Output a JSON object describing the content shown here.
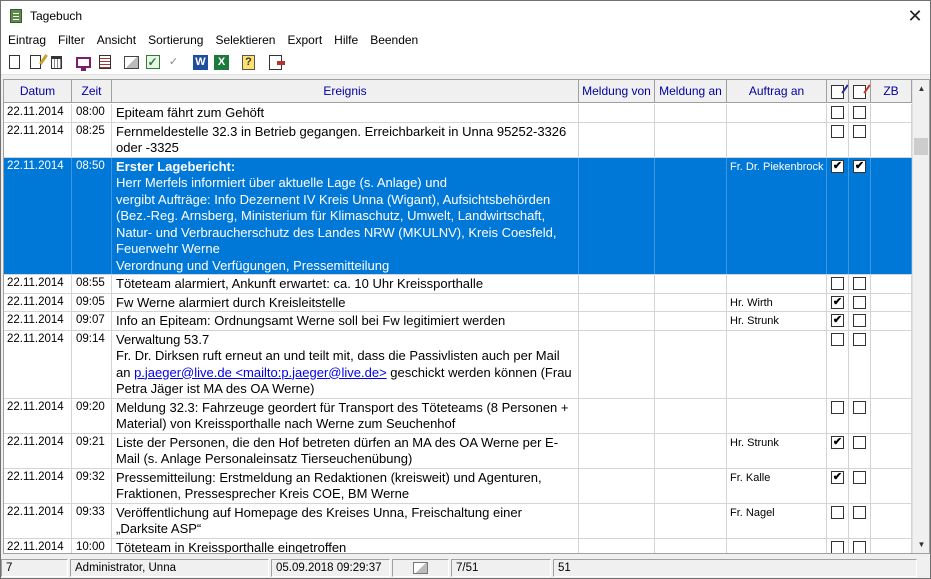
{
  "window": {
    "title": "Tagebuch",
    "close_glyph": "✕"
  },
  "menu": [
    "Eintrag",
    "Filter",
    "Ansicht",
    "Sortierung",
    "Selektieren",
    "Export",
    "Hilfe",
    "Beenden"
  ],
  "toolbar": {
    "icons": [
      "new-entry-icon",
      "edit-entry-icon",
      "delete-entry-icon",
      "monitor-icon",
      "document-list-icon",
      "folders-icon",
      "check-icon",
      "tick-icon",
      "word-export-icon",
      "excel-export-icon",
      "help-icon",
      "exit-icon"
    ],
    "word_glyph": "W",
    "excel_glyph": "X",
    "help_glyph": "?"
  },
  "columns": {
    "date": "Datum",
    "time": "Zeit",
    "event": "Ereignis",
    "meldung_von": "Meldung von",
    "meldung_an": "Meldung an",
    "auftrag_an": "Auftrag an",
    "zb": "ZB"
  },
  "rows": [
    {
      "date": "22.11.2014",
      "time": "08:00",
      "event": [
        "Epiteam fährt zum Gehöft"
      ],
      "auftrag": "",
      "cb1": "",
      "cb2": ""
    },
    {
      "date": "22.11.2014",
      "time": "08:25",
      "event": [
        "Fernmeldestelle 32.3 in Betrieb gegangen. Erreichbarkeit in Unna 95252-3326",
        "oder -3325"
      ],
      "auftrag": "",
      "cb1": "",
      "cb2": ""
    },
    {
      "date": "22.11.2014",
      "time": "08:50",
      "title": "Erster Lagebericht:",
      "event": [
        "Herr Merfels informiert über aktuelle Lage (s. Anlage) und",
        "vergibt Aufträge: Info Dezernent IV Kreis Unna (Wigant), Aufsichtsbehörden",
        "(Bez.-Reg. Arnsberg, Ministerium für Klimaschutz, Umwelt, Landwirtschaft,",
        "Natur- und Verbraucherschutz des Landes NRW (MKULNV), Kreis Coesfeld,",
        "Feuerwehr Werne",
        "Verordnung und Verfügungen, Pressemitteilung"
      ],
      "auftrag": "Fr. Dr. Piekenbrock",
      "cb1": "✔",
      "cb2": "✔",
      "selected": true
    },
    {
      "date": "22.11.2014",
      "time": "08:55",
      "event": [
        "Töteteam alarmiert, Ankunft erwartet: ca. 10 Uhr Kreissporthalle"
      ],
      "auftrag": "",
      "cb1": "",
      "cb2": ""
    },
    {
      "date": "22.11.2014",
      "time": "09:05",
      "event": [
        "Fw Werne alarmiert durch Kreisleitstelle"
      ],
      "auftrag": "Hr. Wirth",
      "cb1": "✔",
      "cb2": ""
    },
    {
      "date": "22.11.2014",
      "time": "09:07",
      "event": [
        "Info an Epiteam: Ordnungsamt Werne soll bei Fw legitimiert werden"
      ],
      "auftrag": "Hr. Strunk",
      "cb1": "✔",
      "cb2": ""
    },
    {
      "date": "22.11.2014",
      "time": "09:14",
      "event": [
        "Verwaltung 53.7",
        "Fr. Dr. Dirksen ruft erneut an und teilt mit, dass die Passivlisten auch per Mail"
      ],
      "link_prefix": "an ",
      "link_text": "p.jaeger@live.de <mailto:p.jaeger@live.de>",
      "link_suffix": " geschickt werden können (Frau",
      "event_after": [
        "Petra Jäger ist MA des OA Werne)"
      ],
      "auftrag": "",
      "cb1": "",
      "cb2": ""
    },
    {
      "date": "22.11.2014",
      "time": "09:20",
      "event": [
        "Meldung 32.3: Fahrzeuge geordert für Transport des Töteteams (8 Personen +",
        "Material) von Kreissporthalle nach Werne zum Seuchenhof"
      ],
      "auftrag": "",
      "cb1": "",
      "cb2": ""
    },
    {
      "date": "22.11.2014",
      "time": "09:21",
      "event": [
        "Liste der Personen, die den Hof betreten dürfen an MA des OA Werne per E-",
        "Mail (s. Anlage Personaleinsatz Tierseuchenübung)"
      ],
      "auftrag": "Hr. Strunk",
      "cb1": "✔",
      "cb2": ""
    },
    {
      "date": "22.11.2014",
      "time": "09:32",
      "event": [
        "Pressemitteilung: Erstmeldung an Redaktionen (kreisweit) und Agenturen,",
        "Fraktionen, Pressesprecher Kreis COE, BM Werne"
      ],
      "auftrag": "Fr. Kalle",
      "cb1": "✔",
      "cb2": ""
    },
    {
      "date": "22.11.2014",
      "time": "09:33",
      "event": [
        "Veröffentlichung auf Homepage des Kreises Unna, Freischaltung einer",
        "„Darksite ASP“"
      ],
      "auftrag": "Fr. Nagel",
      "cb1": "",
      "cb2": ""
    },
    {
      "date": "22.11.2014",
      "time": "10:00",
      "event": [
        "Töteteam in Kreissporthalle eingetroffen"
      ],
      "auftrag": "",
      "cb1": "",
      "cb2": ""
    }
  ],
  "scrollbar": {
    "up": "▲",
    "down": "▼"
  },
  "status": {
    "count": "7",
    "user": "Administrator, Unna",
    "datetime": "05.09.2018 09:29:37",
    "position": "7/51",
    "total": "51"
  }
}
